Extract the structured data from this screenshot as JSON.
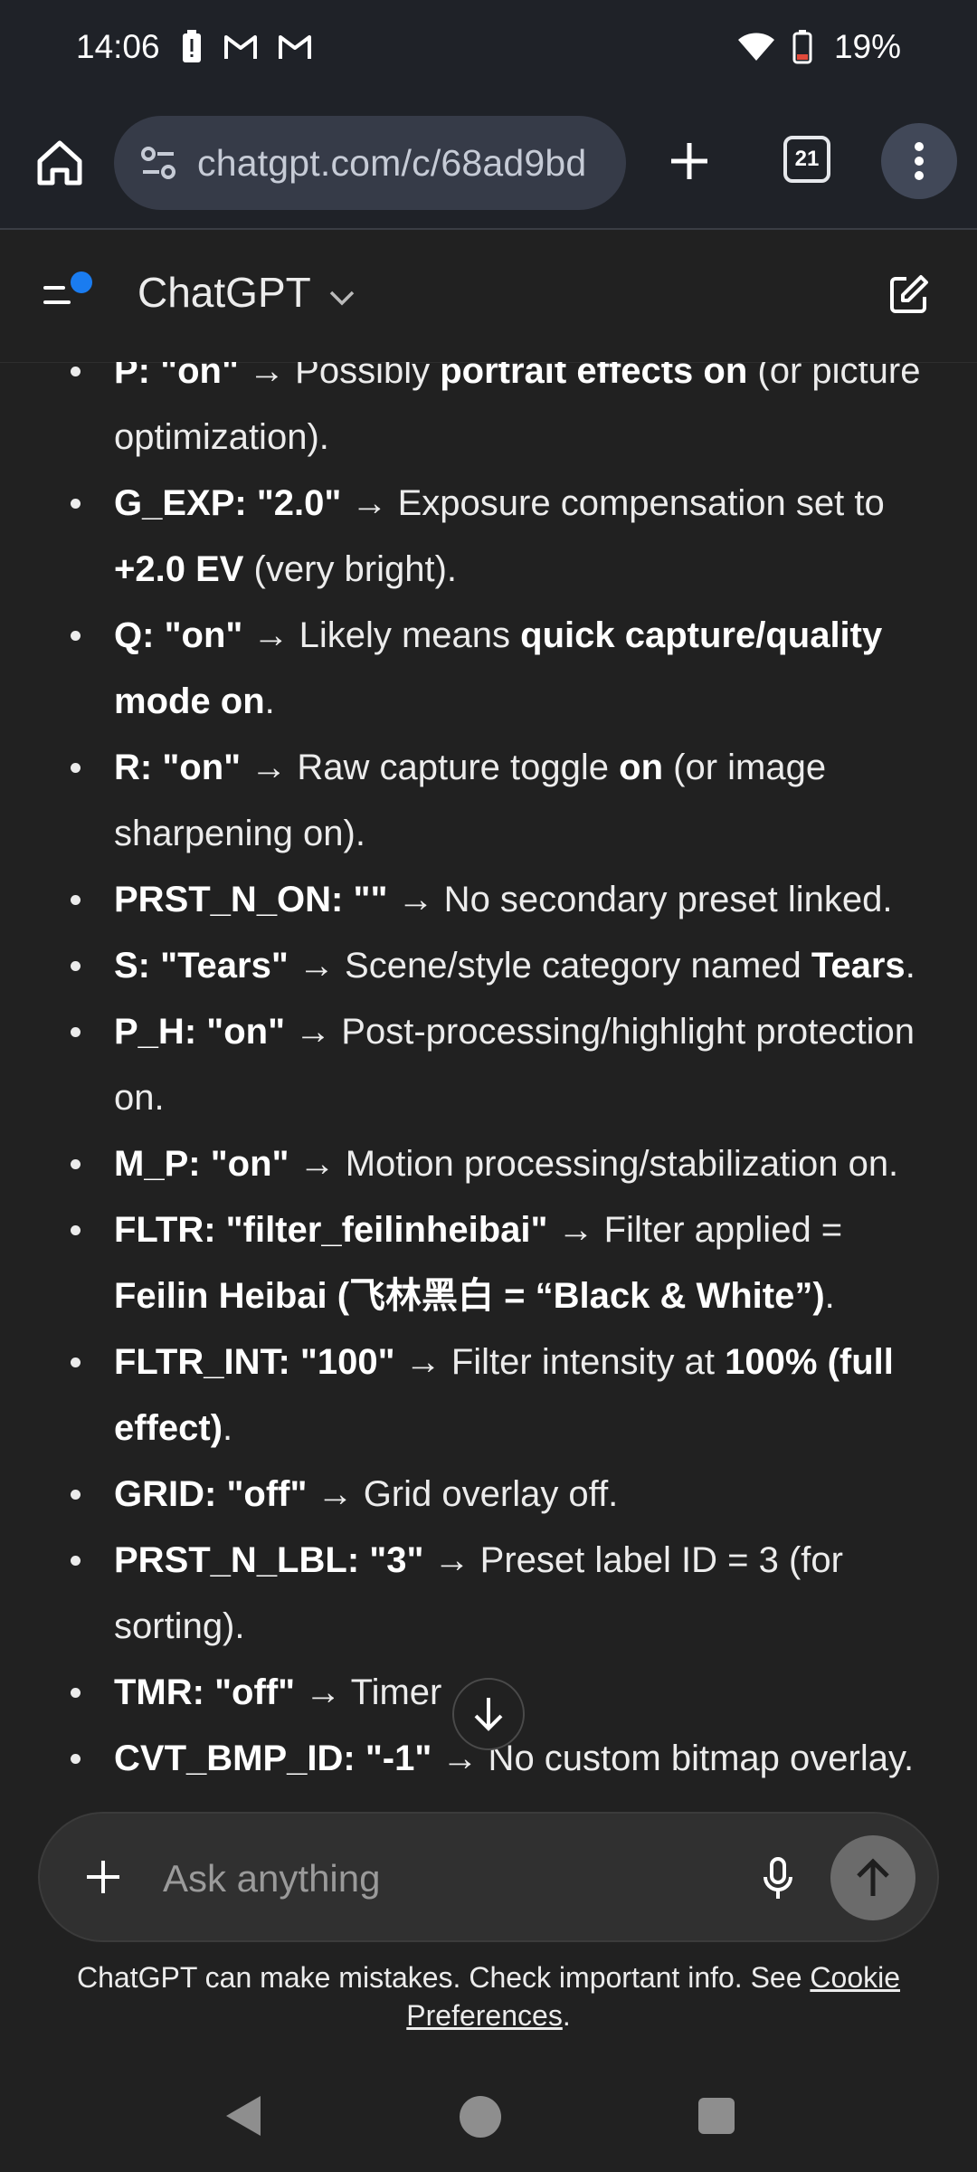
{
  "status_bar": {
    "time": "14:06",
    "battery_percent": "19%",
    "icons": [
      "alert-battery-icon",
      "gmail-icon",
      "gmail-icon",
      "wifi-icon",
      "battery-low-icon"
    ]
  },
  "browser": {
    "url": "chatgpt.com/c/68ad9bd",
    "tab_count": "21"
  },
  "app": {
    "title": "ChatGPT"
  },
  "message": {
    "items": [
      {
        "parts": [
          {
            "b": true,
            "t": "P:"
          },
          {
            "b": false,
            "t": " "
          },
          {
            "b": true,
            "t": "\"on\""
          },
          {
            "b": false,
            "t": " → Possibly "
          },
          {
            "b": true,
            "t": "portrait effects on"
          },
          {
            "b": false,
            "t": " (or picture optimization)."
          }
        ]
      },
      {
        "parts": [
          {
            "b": true,
            "t": "G_EXP:"
          },
          {
            "b": false,
            "t": " "
          },
          {
            "b": true,
            "t": "\"2.0\""
          },
          {
            "b": false,
            "t": " → Exposure compensation set to "
          },
          {
            "b": true,
            "t": "+2.0 EV"
          },
          {
            "b": false,
            "t": " (very bright)."
          }
        ]
      },
      {
        "parts": [
          {
            "b": true,
            "t": "Q:"
          },
          {
            "b": false,
            "t": " "
          },
          {
            "b": true,
            "t": "\"on\""
          },
          {
            "b": false,
            "t": " → Likely means "
          },
          {
            "b": true,
            "t": "quick capture/quality mode on"
          },
          {
            "b": false,
            "t": "."
          }
        ]
      },
      {
        "parts": [
          {
            "b": true,
            "t": "R:"
          },
          {
            "b": false,
            "t": " "
          },
          {
            "b": true,
            "t": "\"on\""
          },
          {
            "b": false,
            "t": " → Raw capture toggle "
          },
          {
            "b": true,
            "t": "on"
          },
          {
            "b": false,
            "t": " (or image sharpening on)."
          }
        ]
      },
      {
        "parts": [
          {
            "b": true,
            "t": "PRST_N_ON:"
          },
          {
            "b": false,
            "t": " "
          },
          {
            "b": true,
            "t": "\"\""
          },
          {
            "b": false,
            "t": " → No secondary preset linked."
          }
        ]
      },
      {
        "parts": [
          {
            "b": true,
            "t": "S:"
          },
          {
            "b": false,
            "t": " "
          },
          {
            "b": true,
            "t": "\"Tears\""
          },
          {
            "b": false,
            "t": " → Scene/style category named "
          },
          {
            "b": true,
            "t": "Tears"
          },
          {
            "b": false,
            "t": "."
          }
        ]
      },
      {
        "parts": [
          {
            "b": true,
            "t": "P_H:"
          },
          {
            "b": false,
            "t": " "
          },
          {
            "b": true,
            "t": "\"on\""
          },
          {
            "b": false,
            "t": " → Post-processing/highlight protection on."
          }
        ]
      },
      {
        "parts": [
          {
            "b": true,
            "t": "M_P:"
          },
          {
            "b": false,
            "t": " "
          },
          {
            "b": true,
            "t": "\"on\""
          },
          {
            "b": false,
            "t": " → Motion processing/stabilization on."
          }
        ]
      },
      {
        "parts": [
          {
            "b": true,
            "t": "FLTR:"
          },
          {
            "b": false,
            "t": " "
          },
          {
            "b": true,
            "t": "\"filter_feilinheibai\""
          },
          {
            "b": false,
            "t": " → Filter applied = "
          },
          {
            "b": true,
            "t": "Feilin Heibai (飞林黑白 = “Black & White”)"
          },
          {
            "b": false,
            "t": "."
          }
        ]
      },
      {
        "parts": [
          {
            "b": true,
            "t": "FLTR_INT:"
          },
          {
            "b": false,
            "t": " "
          },
          {
            "b": true,
            "t": "\"100\""
          },
          {
            "b": false,
            "t": " → Filter intensity at "
          },
          {
            "b": true,
            "t": "100% (full effect)"
          },
          {
            "b": false,
            "t": "."
          }
        ]
      },
      {
        "parts": [
          {
            "b": true,
            "t": "GRID:"
          },
          {
            "b": false,
            "t": " "
          },
          {
            "b": true,
            "t": "\"off\""
          },
          {
            "b": false,
            "t": " → Grid overlay off."
          }
        ]
      },
      {
        "parts": [
          {
            "b": true,
            "t": "PRST_N_LBL:"
          },
          {
            "b": false,
            "t": " "
          },
          {
            "b": true,
            "t": "\"3\""
          },
          {
            "b": false,
            "t": " → Preset label ID = 3 (for sorting)."
          }
        ]
      },
      {
        "parts": [
          {
            "b": true,
            "t": "TMR:"
          },
          {
            "b": false,
            "t": " "
          },
          {
            "b": true,
            "t": "\"off\""
          },
          {
            "b": false,
            "t": " → Timer "
          }
        ]
      },
      {
        "parts": [
          {
            "b": true,
            "t": "CVT_BMP_ID:"
          },
          {
            "b": false,
            "t": " "
          },
          {
            "b": true,
            "t": "\"-1\""
          },
          {
            "b": false,
            "t": " → No custom bitmap overlay."
          }
        ]
      }
    ]
  },
  "composer": {
    "placeholder": "Ask anything"
  },
  "disclaimer": {
    "text": "ChatGPT can make mistakes. Check important info. See ",
    "link": "Cookie Preferences",
    "end": "."
  },
  "colors": {
    "background": "#212121",
    "browser_bar": "#1f2228",
    "url_pill": "#363b48",
    "notification_dot": "#1a7cf0"
  }
}
